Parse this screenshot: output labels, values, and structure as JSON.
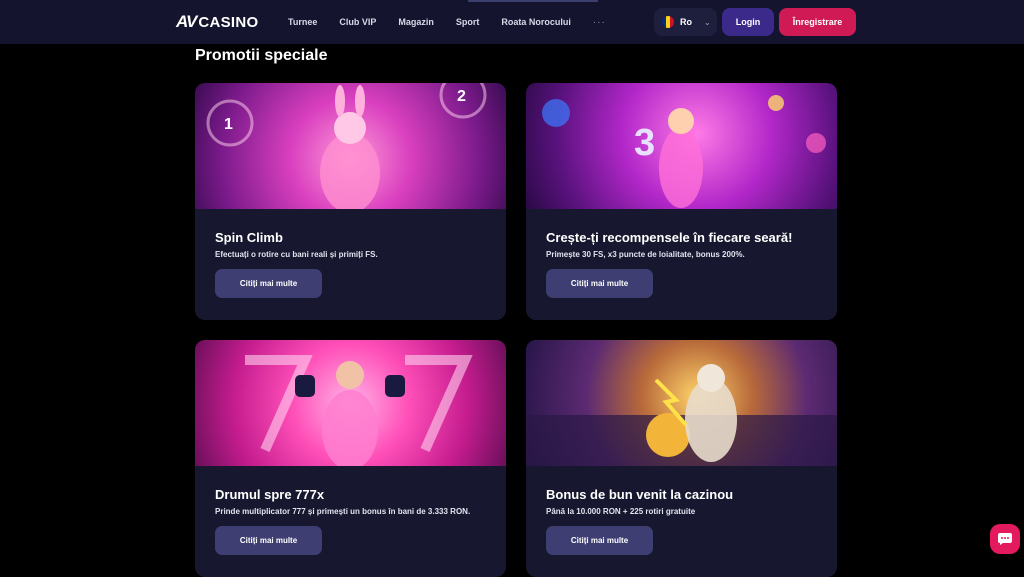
{
  "header": {
    "logo_mark": "AV",
    "logo_text": "CASINO",
    "nav": [
      "Turnee",
      "Club VIP",
      "Magazin",
      "Sport",
      "Roata Norocului"
    ],
    "more": "···",
    "language": "Ro",
    "login": "Login",
    "register": "Înregistrare"
  },
  "section_title": "Promotii speciale",
  "promos": [
    {
      "title": "Spin Climb",
      "desc": "Efectuați o rotire cu bani reali și primiți FS.",
      "button": "Citiți mai multe",
      "img_text": [
        "1",
        "2"
      ]
    },
    {
      "title": "Crește-ți recompensele în fiecare seară!",
      "desc": "Primește 30 FS, x3 puncte de loialitate, bonus 200%.",
      "button": "Citiți mai multe",
      "img_text": [
        "3"
      ]
    },
    {
      "title": "Drumul spre 777x",
      "desc": "Prinde multiplicator 777 și primești un bonus în bani de 3.333 RON.",
      "button": "Citiți mai multe"
    },
    {
      "title": "Bonus de bun venit la cazinou",
      "desc": "Până la 10.000 RON + 225 rotiri gratuite",
      "button": "Citiți mai multe"
    }
  ],
  "colors": {
    "header_bg": "#14142e",
    "card_bg": "#17172f",
    "accent": "#d01a55",
    "login": "#3b2a8a",
    "button": "#3e3e72"
  },
  "icons": {
    "chat": "chat-bubble-icon",
    "chevron": "chevron-down-icon",
    "flag": "romania-flag-icon"
  }
}
